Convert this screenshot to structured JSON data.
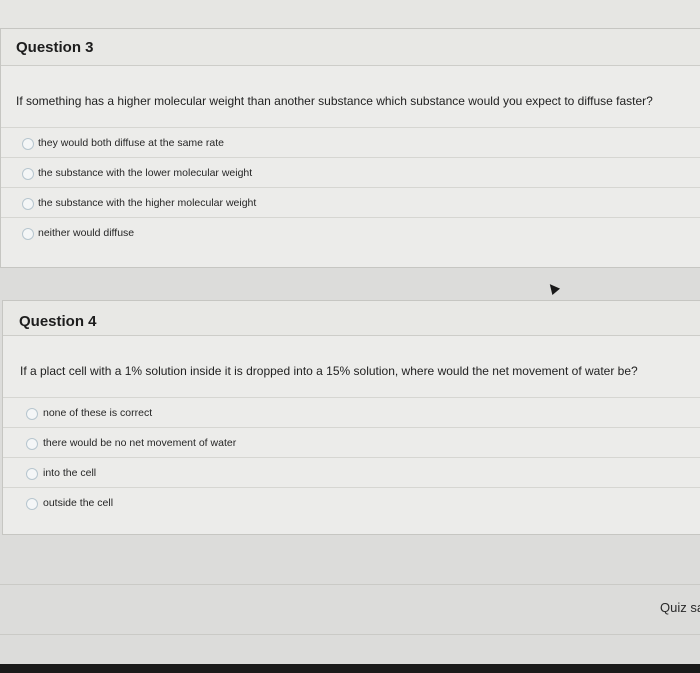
{
  "question3": {
    "title": "Question 3",
    "prompt": "If something has a higher molecular weight than another substance which substance would you expect to diffuse faster?",
    "answers": [
      "they would both diffuse at the same rate",
      "the substance with the lower molecular weight",
      "the substance with the higher molecular weight",
      "neither would diffuse"
    ]
  },
  "question4": {
    "title": "Question 4",
    "prompt": "If a plact cell with a 1% solution inside it is dropped into a 15% solution, where would the net movement of water be?",
    "answers": [
      "none of these is correct",
      "there would be no net movement of water",
      "into the cell",
      "outside the cell"
    ]
  },
  "footer": {
    "quiz_save_label": "Quiz sa"
  }
}
